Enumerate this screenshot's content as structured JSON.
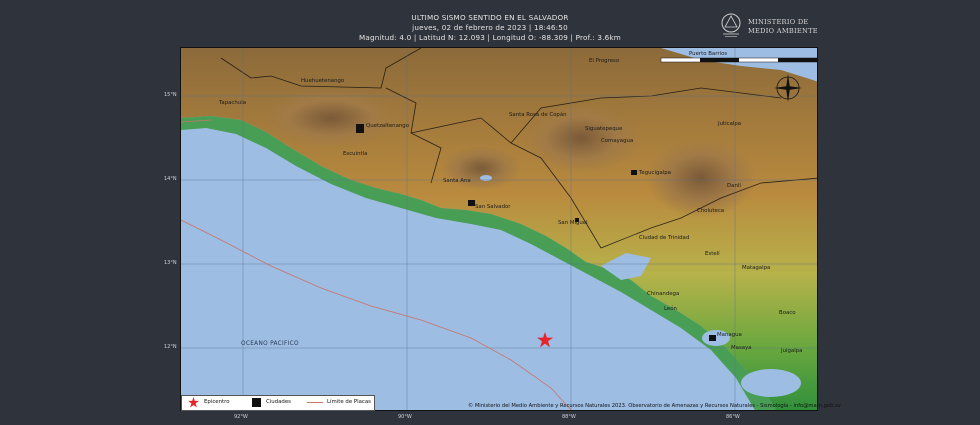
{
  "header": {
    "title": "ULTIMO SISMO SENTIDO EN EL SALVADOR",
    "datetime": "jueves, 02 de febrero de 2023 | 18:46:50",
    "details": "Magnitud: 4.0 | Latitud N: 12.093 | Longitud O: -88.309 | Prof.: 3.6km"
  },
  "logo": {
    "line1": "MINISTERIO DE",
    "line2": "MEDIO AMBIENTE"
  },
  "map": {
    "lat_labels": [
      "15°N",
      "14°N",
      "13°N",
      "12°N"
    ],
    "lon_labels": [
      "92°W",
      "90°W",
      "88°W",
      "86°W"
    ],
    "ocean_label": "OCEANO PACIFICO",
    "places": [
      "Tapachula",
      "Huehuetenango",
      "Quetzaltenango",
      "Escuintla",
      "Santa Ana",
      "San Salvador",
      "San Miguel",
      "Santa Rosa de Copán",
      "Siguatepeque",
      "Comayagua",
      "Tegucigalpa",
      "Juticalpa",
      "Danlí",
      "Choluteca",
      "Ciudad de Trinidad",
      "El Progreso",
      "Chinandega",
      "León",
      "Managua",
      "Masaya",
      "Matagalpa",
      "Estelí",
      "Juigalpa",
      "Boaco",
      "Puerto Barrios"
    ],
    "epicenter_color": "#e8232a",
    "plate_line_color": "#c9736b"
  },
  "legend": {
    "epicenter": "Epicentro",
    "cities": "Ciudades",
    "plates": "Límite de Placas"
  },
  "credit": "© Ministerio del Medio Ambiente y Recursos Naturales 2023. Observatorio de Amenazas y Recursos Naturales - Sismología - info@marn.gob.sv"
}
